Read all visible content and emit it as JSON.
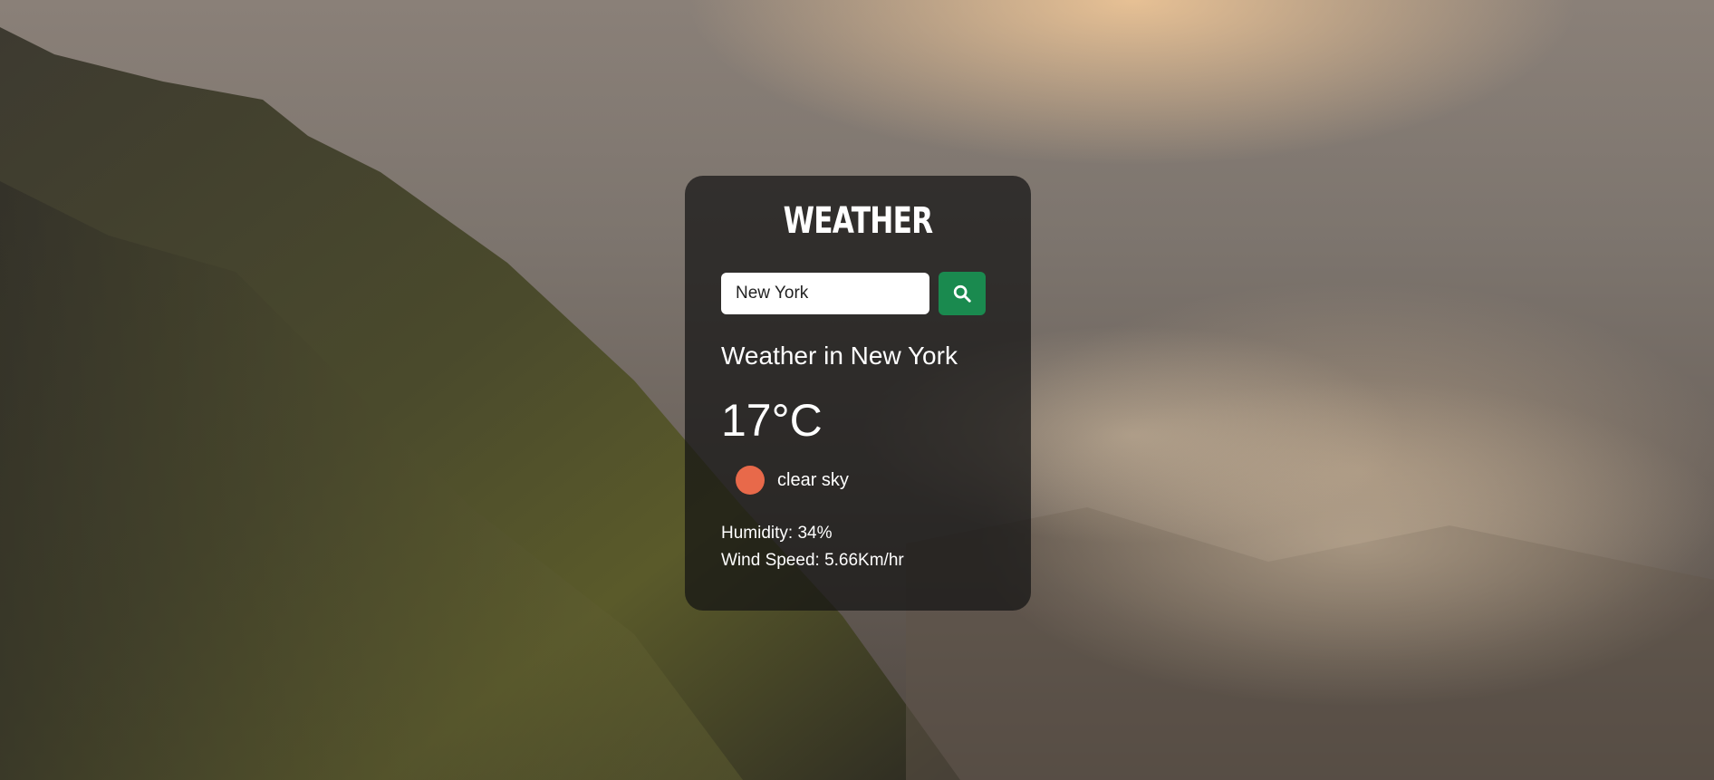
{
  "app": {
    "title": "Weather"
  },
  "search": {
    "value": "New York",
    "placeholder": "Search",
    "button_icon": "search-icon"
  },
  "weather": {
    "heading": "Weather in New York",
    "temperature": "17°C",
    "icon": "clear-sky-icon",
    "description": "clear sky",
    "humidity": "Humidity: 34%",
    "wind": "Wind Speed: 5.66Km/hr"
  },
  "colors": {
    "accent": "#1a8a4f",
    "sun": "#e8694a",
    "card_bg": "rgba(20,20,20,0.72)"
  }
}
